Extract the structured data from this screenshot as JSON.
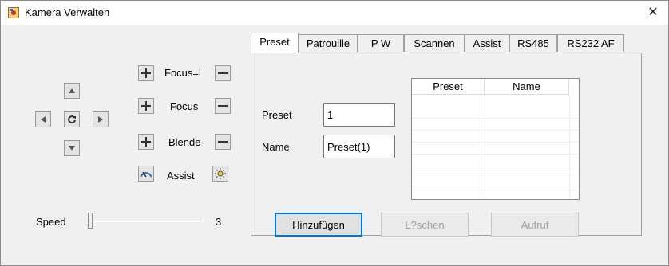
{
  "window": {
    "title": "Kamera Verwalten",
    "close_glyph": "✕"
  },
  "controls": {
    "focus_near_label": "Focus=l",
    "focus_label": "Focus",
    "iris_label": "Blende",
    "assist_label": "Assist",
    "speed_label": "Speed",
    "speed_value": "3"
  },
  "tabs": [
    {
      "label": "Preset",
      "active": true
    },
    {
      "label": "Patrouille",
      "active": false
    },
    {
      "label": "P  W",
      "active": false
    },
    {
      "label": "Scannen",
      "active": false
    },
    {
      "label": "Assist",
      "active": false
    },
    {
      "label": "RS485",
      "active": false
    },
    {
      "label": "RS232  AF",
      "active": false
    }
  ],
  "preset_form": {
    "preset_label": "Preset",
    "preset_value": "1",
    "name_label": "Name",
    "name_value": "Preset(1)"
  },
  "preset_table": {
    "columns": [
      "Preset",
      "Name"
    ],
    "rows": []
  },
  "actions": {
    "add": "Hinzufügen",
    "delete": "L?schen",
    "call": "Aufruf"
  },
  "colors": {
    "accent": "#0078d7",
    "panel": "#f0f0f0"
  }
}
